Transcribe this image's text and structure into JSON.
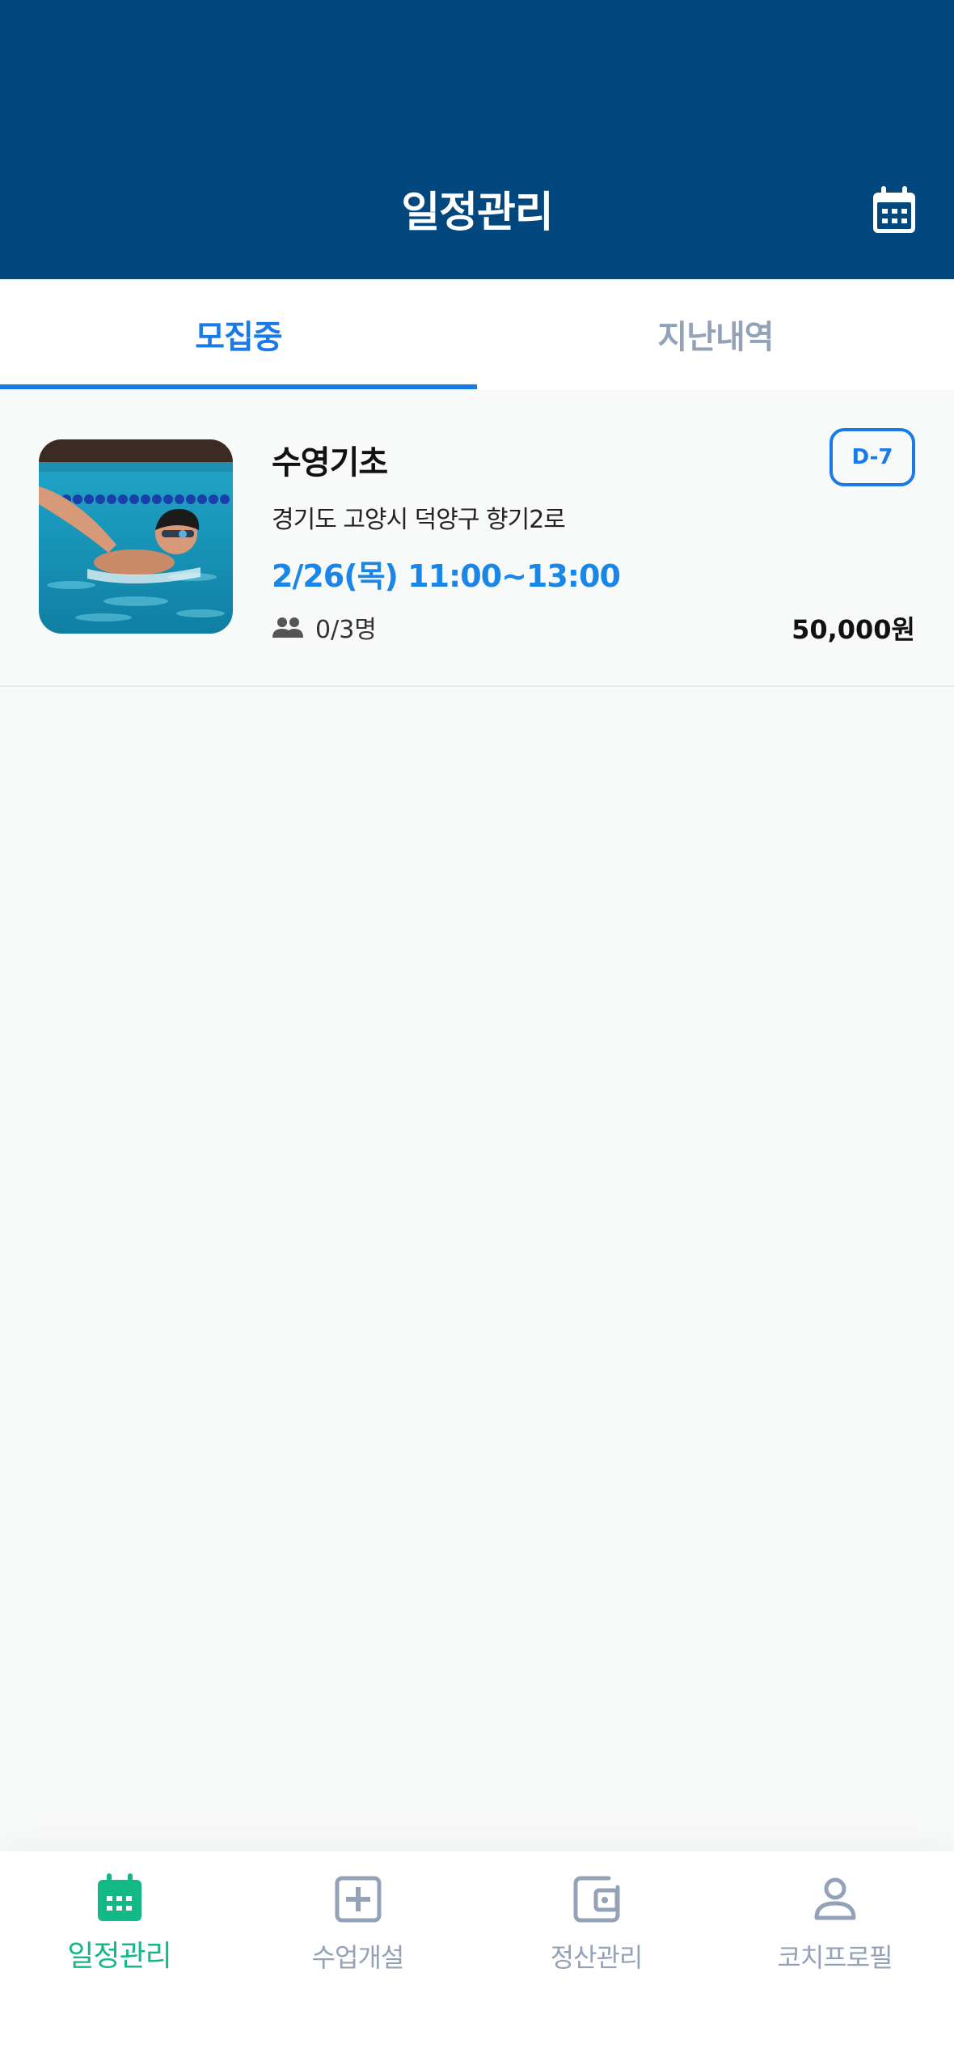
{
  "header": {
    "title": "일정관리",
    "calendar_icon": "calendar-icon"
  },
  "tabs": [
    {
      "label": "모집중",
      "active": true
    },
    {
      "label": "지난내역",
      "active": false
    }
  ],
  "class_card": {
    "title": "수영기초",
    "d_day": "D-7",
    "address": "경기도 고양시 덕양구 향기2로",
    "schedule": "2/26(목) 11:00~13:00",
    "participants": "0/3명",
    "price": "50,000원",
    "image": "swimmer-photo"
  },
  "bottom_nav": [
    {
      "label": "일정관리",
      "icon": "calendar-icon",
      "active": true
    },
    {
      "label": "수업개설",
      "icon": "plus-square-icon",
      "active": false
    },
    {
      "label": "정산관리",
      "icon": "wallet-icon",
      "active": false
    },
    {
      "label": "코치프로필",
      "icon": "person-icon",
      "active": false
    }
  ],
  "colors": {
    "header_bg": "#02487e",
    "accent_blue": "#1a7be8",
    "active_nav": "#12b886",
    "inactive": "#93a2b7"
  }
}
